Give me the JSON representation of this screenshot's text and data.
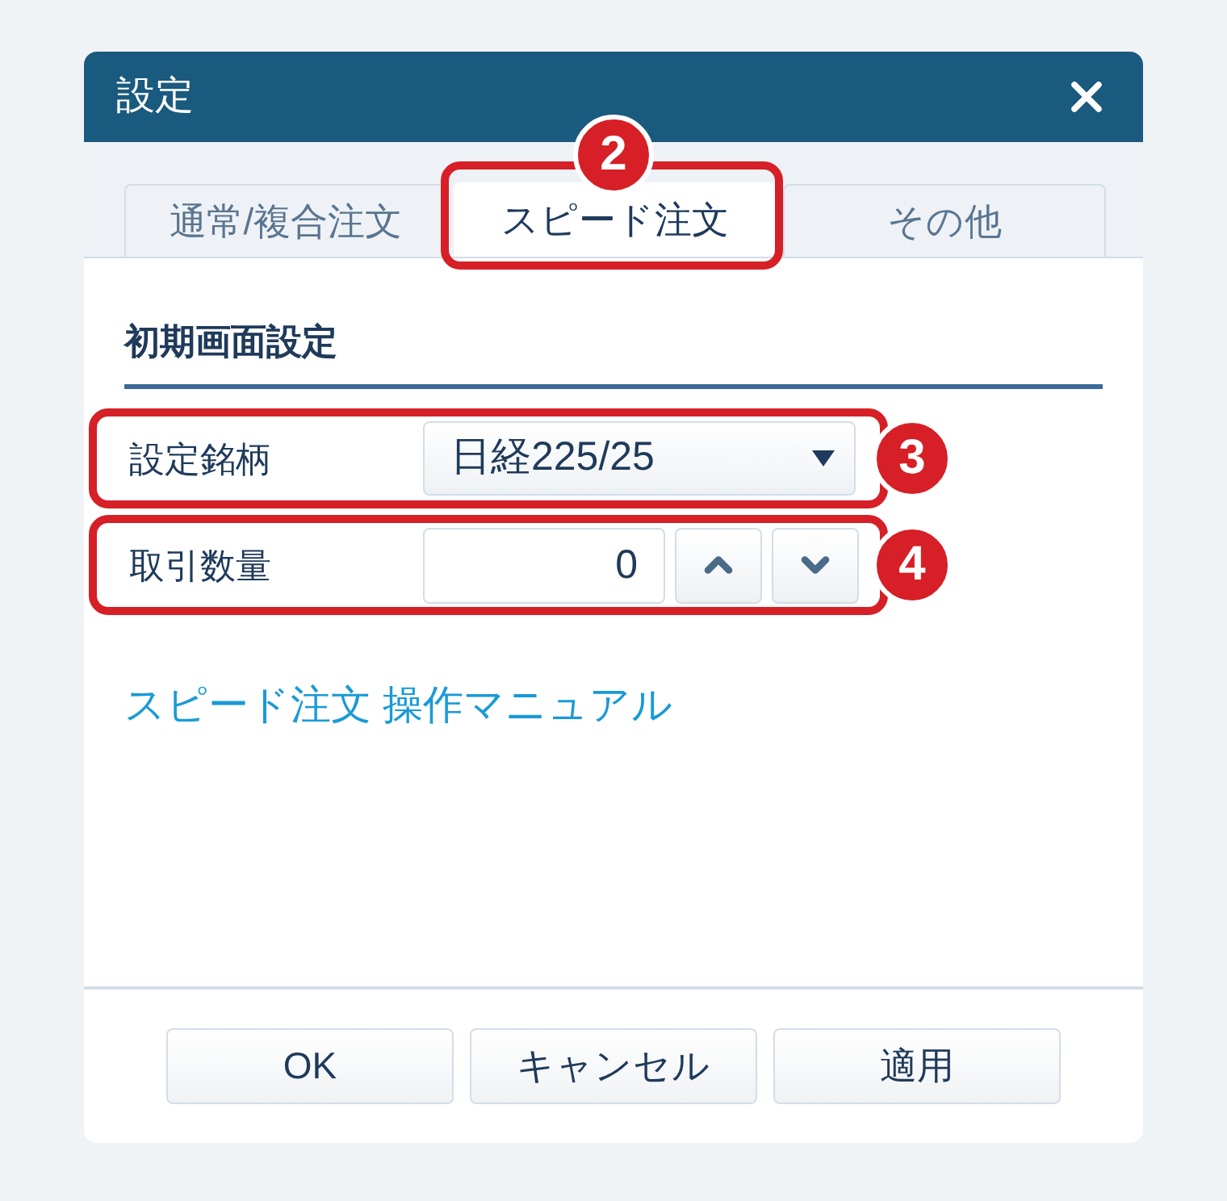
{
  "window": {
    "title": "設定"
  },
  "tabs": [
    {
      "label": "通常/複合注文",
      "selected": false
    },
    {
      "label": "スピード注文",
      "selected": true,
      "callout": "2"
    },
    {
      "label": "その他",
      "selected": false
    }
  ],
  "section": {
    "title": "初期画面設定"
  },
  "rows": [
    {
      "kind": "select",
      "label": "設定銘柄",
      "value": "日経225/25",
      "callout": "3"
    },
    {
      "kind": "stepper",
      "label": "取引数量",
      "value": "0",
      "callout": "4"
    }
  ],
  "link": "スピード注文 操作マニュアル",
  "buttons": [
    "OK",
    "キャンセル",
    "適用"
  ]
}
